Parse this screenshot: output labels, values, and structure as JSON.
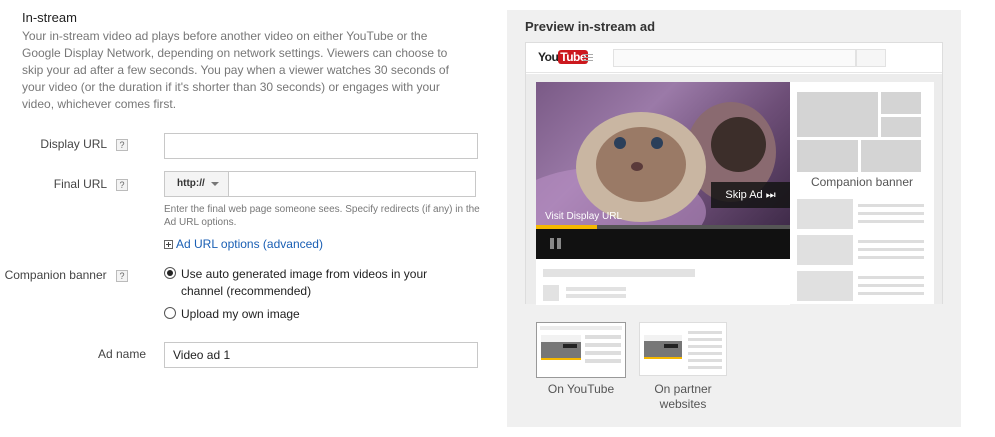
{
  "section": {
    "title": "In-stream",
    "description": "Your in-stream video ad plays before another video on either YouTube or the Google Display Network, depending on network settings. Viewers can choose to skip your ad after a few seconds. You pay when a viewer watches 30 seconds of your video (or the duration if it's shorter than 30 seconds) or engages with your video, whichever comes first."
  },
  "form": {
    "display_url": {
      "label": "Display URL",
      "help": "?",
      "value": ""
    },
    "final_url": {
      "label": "Final URL",
      "help": "?",
      "protocol": "http://",
      "value": "",
      "hint": "Enter the final web page someone sees. Specify redirects (if any) in the Ad URL options."
    },
    "ad_url_options": "Ad URL options (advanced)",
    "companion_banner": {
      "label": "Companion banner",
      "help": "?",
      "options": [
        {
          "label": "Use auto generated image from videos in your channel (recommended)",
          "checked": true
        },
        {
          "label": "Upload my own image",
          "checked": false
        }
      ]
    },
    "ad_name": {
      "label": "Ad name",
      "value": "Video ad 1"
    }
  },
  "preview": {
    "title": "Preview in-stream ad",
    "youtube_logo_you": "You",
    "youtube_logo_tube": "Tube",
    "skip_ad": "Skip Ad ⏭",
    "visit_display_url": "Visit Display URL",
    "progress_fraction": 0.24,
    "companion_banner": "Companion banner",
    "thumbs": [
      {
        "label": "On YouTube",
        "selected": true
      },
      {
        "label": "On partner websites",
        "selected": false
      }
    ],
    "colors": {
      "youtube_red": "#cc181e",
      "progress": "#f5b800",
      "link": "#1a5fb4"
    }
  }
}
